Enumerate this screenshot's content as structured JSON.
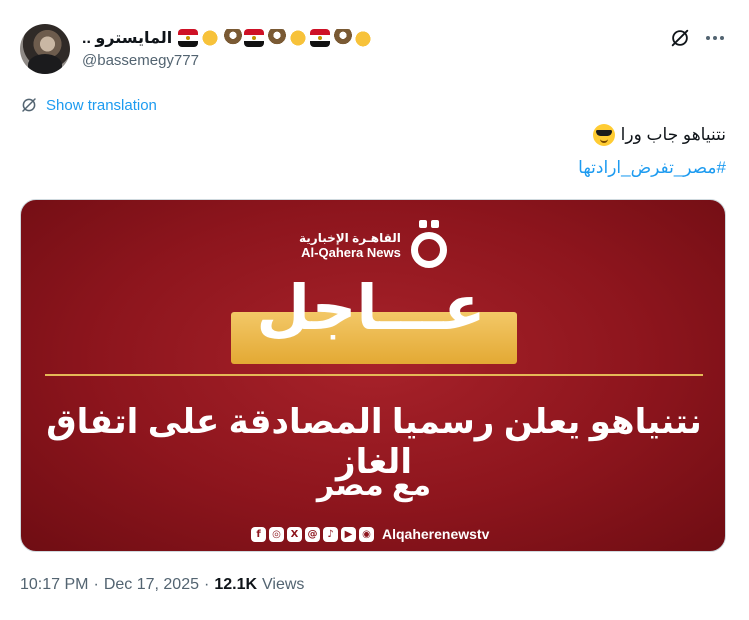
{
  "author": {
    "display_name": "المايسترو ..",
    "handle": "@bassemegy777",
    "emoji_sequence": [
      "flag-egypt",
      "fist",
      "eagle",
      "flag-egypt",
      "eagle",
      "fist",
      "flag-egypt",
      "eagle",
      "muscle"
    ]
  },
  "translation": {
    "label": "Show translation"
  },
  "tweet": {
    "text": "نتنياهو جاب ورا",
    "hashtag": "#مصر_تفرض_ارادتها"
  },
  "media": {
    "logo_arabic": "القاهـرة الإخبارية",
    "logo_english": "Al-Qahera News",
    "badge": "عـــاجل",
    "headline_line1": "نتنياهو يعلن رسميا المصادقة على اتفاق الغاز",
    "headline_line2": "مع مصر",
    "social_icons": [
      "f",
      "◎",
      "X",
      "@",
      "♪",
      "▶",
      "◉"
    ],
    "social_handle": "Alqaherenewstv",
    "colors": {
      "background": "#8d151d",
      "badge": "#e8b446",
      "rule": "#e5b957"
    }
  },
  "meta": {
    "time": "10:17 PM",
    "separator": "·",
    "date": "Dec 17, 2025",
    "views_count": "12.1K",
    "views_label": "Views"
  },
  "colors": {
    "link": "#1d9bf0",
    "secondary_text": "#536471",
    "primary_text": "#0f1419"
  }
}
